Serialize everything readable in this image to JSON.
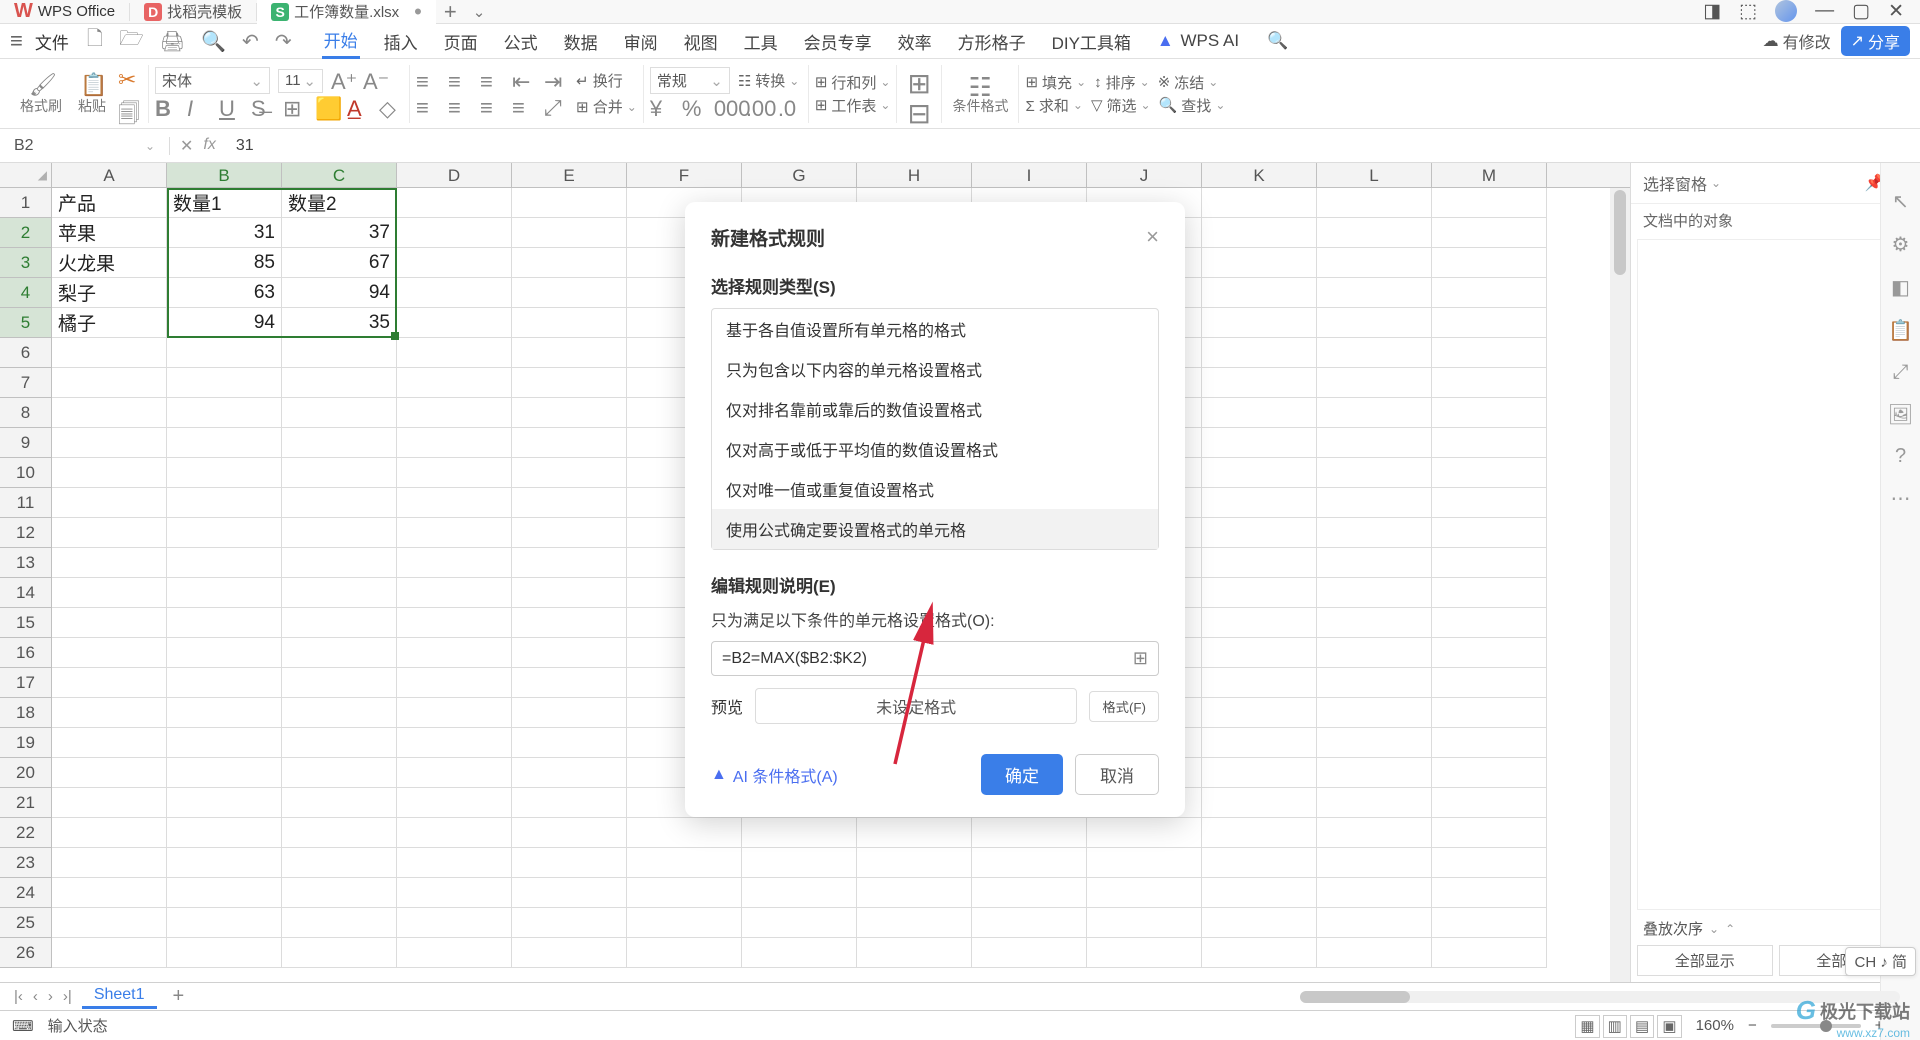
{
  "titlebar": {
    "wps_label": "WPS Office",
    "tpl_label": "找稻壳模板",
    "file_label": "工作簿数量.xlsx"
  },
  "quickaccess": {
    "file": "文件"
  },
  "menutabs": [
    "开始",
    "插入",
    "页面",
    "公式",
    "数据",
    "审阅",
    "视图",
    "工具",
    "会员专享",
    "效率",
    "方形格子",
    "DIY工具箱"
  ],
  "wpsai": "WPS AI",
  "modify": "有修改",
  "share": "分享",
  "ribbon": {
    "format_brush": "格式刷",
    "paste": "粘贴",
    "font": "宋体",
    "size": "11",
    "normal": "常规",
    "convert": "转换",
    "rowcol": "行和列",
    "worksheet": "工作表",
    "cond_format": "条件格式",
    "fill": "填充",
    "sort": "排序",
    "freeze": "冻结",
    "filter": "筛选",
    "find": "查找"
  },
  "cellref": "B2",
  "fxval": "31",
  "columns": [
    "A",
    "B",
    "C",
    "D",
    "E",
    "F",
    "G",
    "H",
    "I",
    "J",
    "K",
    "L",
    "M"
  ],
  "headers": [
    "产品",
    "数量1",
    "数量2"
  ],
  "data_rows": [
    {
      "name": "苹果",
      "q1": "31",
      "q2": "37"
    },
    {
      "name": "火龙果",
      "q1": "85",
      "q2": "67"
    },
    {
      "name": "梨子",
      "q1": "63",
      "q2": "94"
    },
    {
      "name": "橘子",
      "q1": "94",
      "q2": "35"
    }
  ],
  "chart_data": {
    "type": "table",
    "columns": [
      "产品",
      "数量1",
      "数量2"
    ],
    "rows": [
      [
        "苹果",
        31,
        37
      ],
      [
        "火龙果",
        85,
        67
      ],
      [
        "梨子",
        63,
        94
      ],
      [
        "橘子",
        94,
        35
      ]
    ]
  },
  "sidepanel": {
    "title": "选择窗格",
    "sub": "文档中的对象",
    "stack": "叠放次序",
    "show_all": "全部显示",
    "hide_all": "全部隐藏"
  },
  "sheet": "Sheet1",
  "status_text": "输入状态",
  "zoom": "160%",
  "dialog": {
    "title": "新建格式规则",
    "section1": "选择规则类型(S)",
    "rules": [
      "基于各自值设置所有单元格的格式",
      "只为包含以下内容的单元格设置格式",
      "仅对排名靠前或靠后的数值设置格式",
      "仅对高于或低于平均值的数值设置格式",
      "仅对唯一值或重复值设置格式",
      "使用公式确定要设置格式的单元格"
    ],
    "section2": "编辑规则说明(E)",
    "desc": "只为满足以下条件的单元格设置格式(O):",
    "formula": "=B2=MAX($B2:$K2)",
    "preview_label": "预览",
    "preview_text": "未设定格式",
    "format_btn": "格式(F)",
    "ai_link": "AI 条件格式(A)",
    "ok": "确定",
    "cancel": "取消"
  },
  "lang_badge": "CH ♪ 简",
  "watermark_name": "极光下载站",
  "watermark_url": "www.xz7.com"
}
